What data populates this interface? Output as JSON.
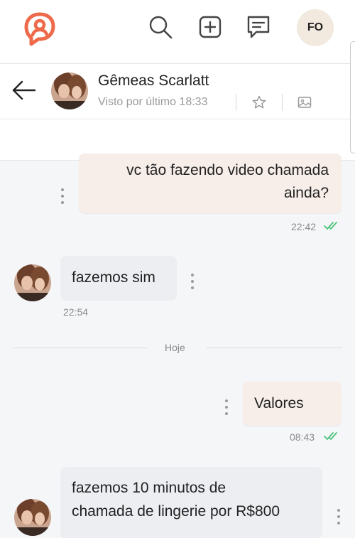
{
  "topbar": {
    "logo": "logo-icon",
    "search_icon": "search-icon",
    "add_icon": "add-post-icon",
    "messages_icon": "message-icon",
    "user_initials": "FO",
    "brand_color": "#ee6a4b"
  },
  "chat": {
    "contact_name": "Gêmeas Scarlatt",
    "status": "Visto por último 18:33",
    "star_icon": "star-icon",
    "media_icon": "image-icon"
  },
  "messages": [
    {
      "direction": "out",
      "lines": [
        "vc tão fazendo video chamada",
        "ainda?"
      ],
      "time": "22:42",
      "read": true
    },
    {
      "direction": "in",
      "lines": [
        "fazemos sim"
      ],
      "time": "22:54"
    },
    {
      "direction": "out",
      "lines": [
        "Valores"
      ],
      "time": "08:43",
      "read": true
    },
    {
      "direction": "in",
      "lines": [
        "fazemos 10 minutos de",
        "chamada de lingerie por R$800"
      ]
    }
  ],
  "day_divider": "Hoje",
  "colors": {
    "read_check": "#4cc37a",
    "out_bubble": "#f7ede9",
    "in_bubble": "#eceef2"
  }
}
